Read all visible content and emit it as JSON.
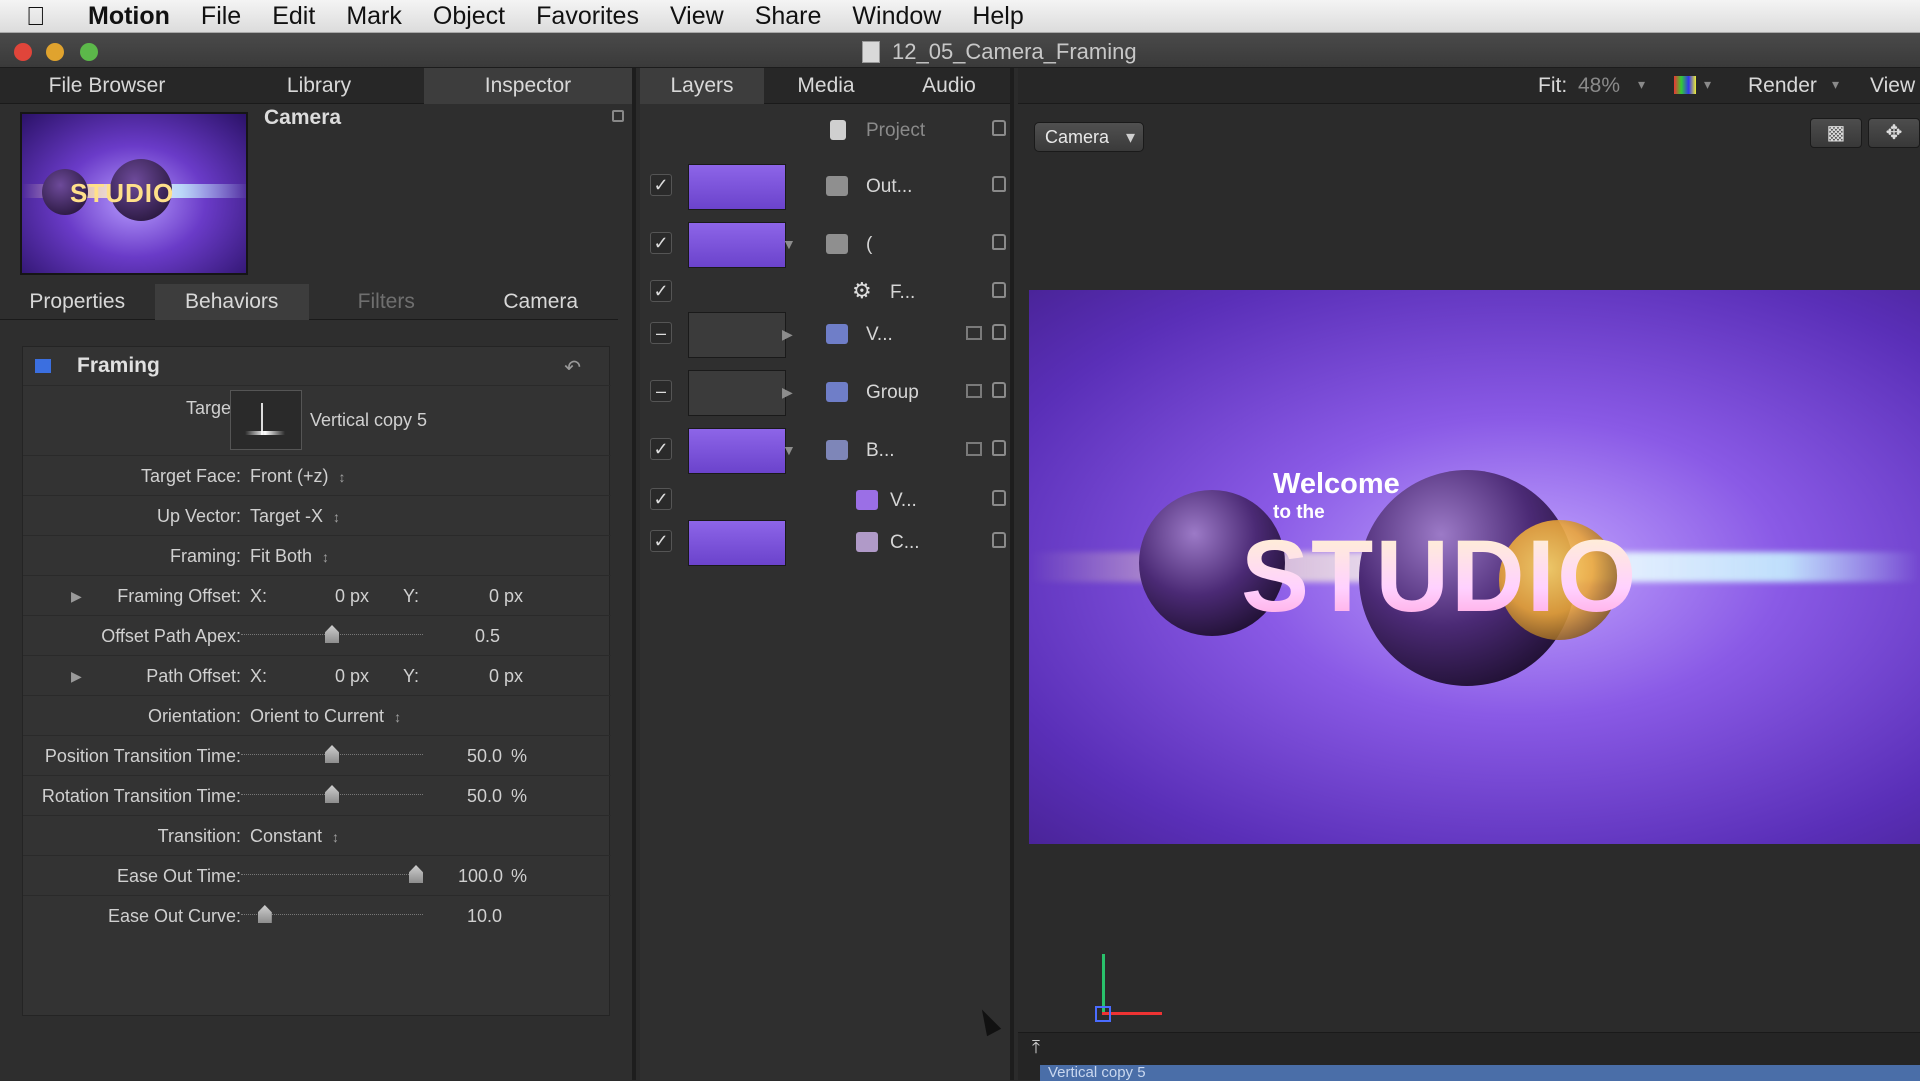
{
  "menubar": {
    "app": "Motion",
    "items": [
      "File",
      "Edit",
      "Mark",
      "Object",
      "Favorites",
      "View",
      "Share",
      "Window",
      "Help"
    ]
  },
  "window": {
    "title": "12_05_Camera_Framing"
  },
  "left_tabs": [
    "File Browser",
    "Library",
    "Inspector"
  ],
  "inspector": {
    "object_name": "Camera",
    "preview_text": "STUDIO",
    "subtabs": [
      "Properties",
      "Behaviors",
      "Filters",
      "Camera"
    ],
    "behavior": {
      "name": "Framing",
      "target_label": "Target:",
      "target_value": "Vertical copy 5",
      "rows": [
        {
          "label": "Target Face:",
          "value": "Front (+z)"
        },
        {
          "label": "Up Vector:",
          "value": "Target -X"
        },
        {
          "label": "Framing:",
          "value": "Fit Both"
        },
        {
          "label": "Framing Offset:",
          "x_label": "X:",
          "x": "0 px",
          "y_label": "Y:",
          "y": "0 px"
        },
        {
          "label": "Offset Path Apex:",
          "value": "0.5",
          "slider": 0.5
        },
        {
          "label": "Path Offset:",
          "x_label": "X:",
          "x": "0 px",
          "y_label": "Y:",
          "y": "0 px"
        },
        {
          "label": "Orientation:",
          "value": "Orient to Current"
        },
        {
          "label": "Position Transition Time:",
          "value": "50.0",
          "unit": "%",
          "slider": 0.5
        },
        {
          "label": "Rotation Transition Time:",
          "value": "50.0",
          "unit": "%",
          "slider": 0.5
        },
        {
          "label": "Transition:",
          "value": "Constant"
        },
        {
          "label": "Ease Out Time:",
          "value": "100.0",
          "unit": "%",
          "slider": 1.0
        },
        {
          "label": "Ease Out Curve:",
          "value": "10.0",
          "slider": 0.1
        }
      ]
    }
  },
  "mid_tabs": [
    "Layers",
    "Media",
    "Audio"
  ],
  "layers": [
    {
      "name": "Project",
      "checked": null
    },
    {
      "name": "Out...",
      "checked": true
    },
    {
      "name": "(",
      "checked": true
    },
    {
      "name": "F...",
      "checked": true
    },
    {
      "name": "V...",
      "checked": false
    },
    {
      "name": "Group",
      "checked": false
    },
    {
      "name": "B...",
      "checked": true
    },
    {
      "name": "V...",
      "checked": true
    },
    {
      "name": "C...",
      "checked": true
    }
  ],
  "canvas_toolbar": {
    "fit_label": "Fit:",
    "fit_value": "48%",
    "render": "Render",
    "view": "View"
  },
  "canvas": {
    "camera_popup": "Camera",
    "welcome": "Welcome",
    "to_the": "to the",
    "studio": "STUDIO"
  },
  "timeline": {
    "bar_label": "Vertical copy 5"
  },
  "colors": {
    "accent": "#3b6fe0",
    "stage": "#8a5ae6"
  }
}
